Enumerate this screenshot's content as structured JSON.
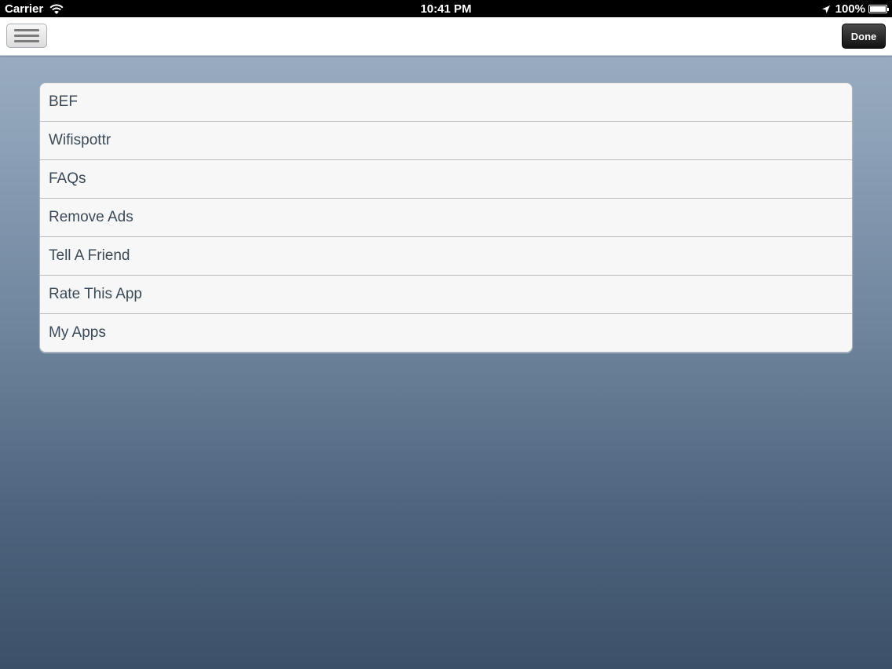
{
  "status_bar": {
    "carrier": "Carrier",
    "time": "10:41 PM",
    "battery": "100%"
  },
  "nav": {
    "menu_icon": "hamburger-menu-icon",
    "done_label": "Done"
  },
  "menu": {
    "items": [
      {
        "label": "BEF"
      },
      {
        "label": "Wifispottr"
      },
      {
        "label": "FAQs"
      },
      {
        "label": "Remove Ads"
      },
      {
        "label": "Tell A Friend"
      },
      {
        "label": "Rate This App"
      },
      {
        "label": "My Apps"
      }
    ]
  },
  "colors": {
    "background_top": "#9fb2c7",
    "background_bottom": "#3c5068",
    "row_text": "#3b4a58"
  }
}
